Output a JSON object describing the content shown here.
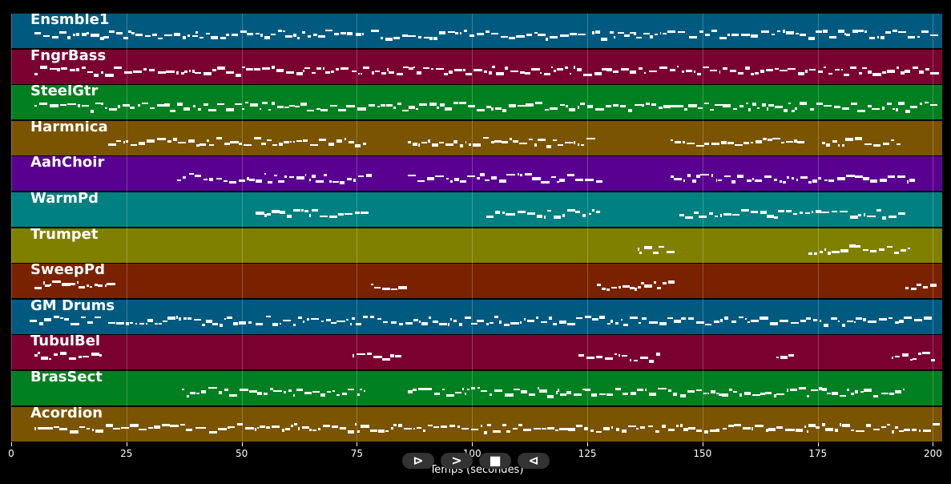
{
  "tracks": [
    {
      "name": "Ensmble1",
      "color": "#005a80",
      "segments": [
        [
          5,
          20
        ],
        [
          20,
          40
        ],
        [
          40,
          52
        ],
        [
          53,
          77
        ],
        [
          78,
          100
        ],
        [
          101,
          124
        ],
        [
          126,
          146
        ],
        [
          147,
          200
        ]
      ]
    },
    {
      "name": "FngrBass",
      "color": "#7a0030",
      "segments": [
        [
          5,
          200
        ]
      ]
    },
    {
      "name": "SteelGtr",
      "color": "#008020",
      "segments": [
        [
          5,
          200
        ]
      ]
    },
    {
      "name": "Harmnica",
      "color": "#7a5400",
      "segments": [
        [
          21,
          77
        ],
        [
          86,
          127
        ],
        [
          143,
          172
        ],
        [
          176,
          193
        ]
      ]
    },
    {
      "name": "AahChoir",
      "color": "#5a0090",
      "segments": [
        [
          36,
          52
        ],
        [
          53,
          77
        ],
        [
          86,
          100
        ],
        [
          101,
          127
        ],
        [
          143,
          195
        ]
      ]
    },
    {
      "name": "WarmPd",
      "color": "#008080",
      "segments": [
        [
          53,
          77
        ],
        [
          103,
          127
        ],
        [
          145,
          194
        ]
      ]
    },
    {
      "name": "Trumpet",
      "color": "#808000",
      "segments": [
        [
          136,
          144
        ],
        [
          173,
          195
        ]
      ]
    },
    {
      "name": "SweepPd",
      "color": "#7a2200",
      "segments": [
        [
          5,
          21
        ],
        [
          78,
          85
        ],
        [
          127,
          143
        ],
        [
          194,
          201
        ]
      ]
    },
    {
      "name": "GM Drums",
      "color": "#005a80",
      "segments": [
        [
          4,
          20
        ],
        [
          21,
          52
        ],
        [
          53,
          100
        ],
        [
          101,
          200
        ]
      ]
    },
    {
      "name": "TubulBel",
      "color": "#7a0030",
      "segments": [
        [
          5,
          20
        ],
        [
          74,
          85
        ],
        [
          123,
          141
        ],
        [
          166,
          170
        ],
        [
          191,
          201
        ]
      ]
    },
    {
      "name": "BrasSect",
      "color": "#008020",
      "segments": [
        [
          37,
          77
        ],
        [
          86,
          194
        ]
      ]
    },
    {
      "name": "Acordion",
      "color": "#7a5400",
      "segments": [
        [
          5,
          201
        ]
      ]
    }
  ],
  "axis": {
    "title": "Temps (secondes)",
    "ticks": [
      "0",
      "25",
      "50",
      "75",
      "100",
      "125",
      "150",
      "175",
      "200"
    ],
    "tick_values": [
      0,
      25,
      50,
      75,
      100,
      125,
      150,
      175,
      200
    ],
    "xlim": [
      0,
      202
    ]
  },
  "controls": {
    "play_label": "⊳",
    "forward_label": ">",
    "stop_label": "■",
    "back_label": "⊲"
  }
}
